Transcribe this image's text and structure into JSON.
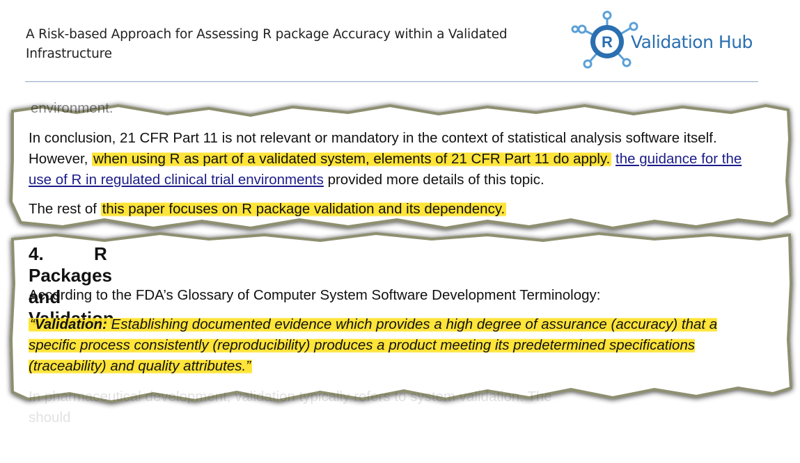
{
  "header": {
    "title": "A Risk-based Approach for Assessing R package Accuracy within a Validated Infrastructure",
    "logo_letter": "R",
    "logo_text": "Validation Hub"
  },
  "excerpt1": {
    "cutoff_top": "environment.",
    "p1_a": "In conclusion, 21 CFR Part 11 is not relevant or mandatory in the context of statistical analysis software itself. However, ",
    "p1_hl": "when using R as part of a validated system, elements of 21 CFR Part 11 do apply.",
    "p1_space": " ",
    "p1_link": "the guidance for the use of R in regulated clinical trial environments",
    "p1_b": " provided more details of this topic.",
    "p2_a": "The rest of ",
    "p2_hl": "this paper focuses on R package validation and its dependency."
  },
  "excerpt2": {
    "heading_num": "4.",
    "heading_text": "R Packages and Validation",
    "p1": "According to the FDA’s Glossary of Computer System Software Development Terminology:",
    "quote_open": "“",
    "quote_term": "Validation:",
    "quote_body": " Establishing documented evidence which provides a high degree of assurance (accuracy) that a specific process consistently (reproducibility) produces a product meeting its predetermined specifications (traceability) and quality attributes.”",
    "faded_line1": "In pharmaceutical development, validation typically refers to system validation. The",
    "faded_line2": "should"
  },
  "colors": {
    "highlight": "#ffe228",
    "link": "#1b1b8a",
    "logo": "#2a6fb0",
    "rule": "#8ea8c8"
  }
}
